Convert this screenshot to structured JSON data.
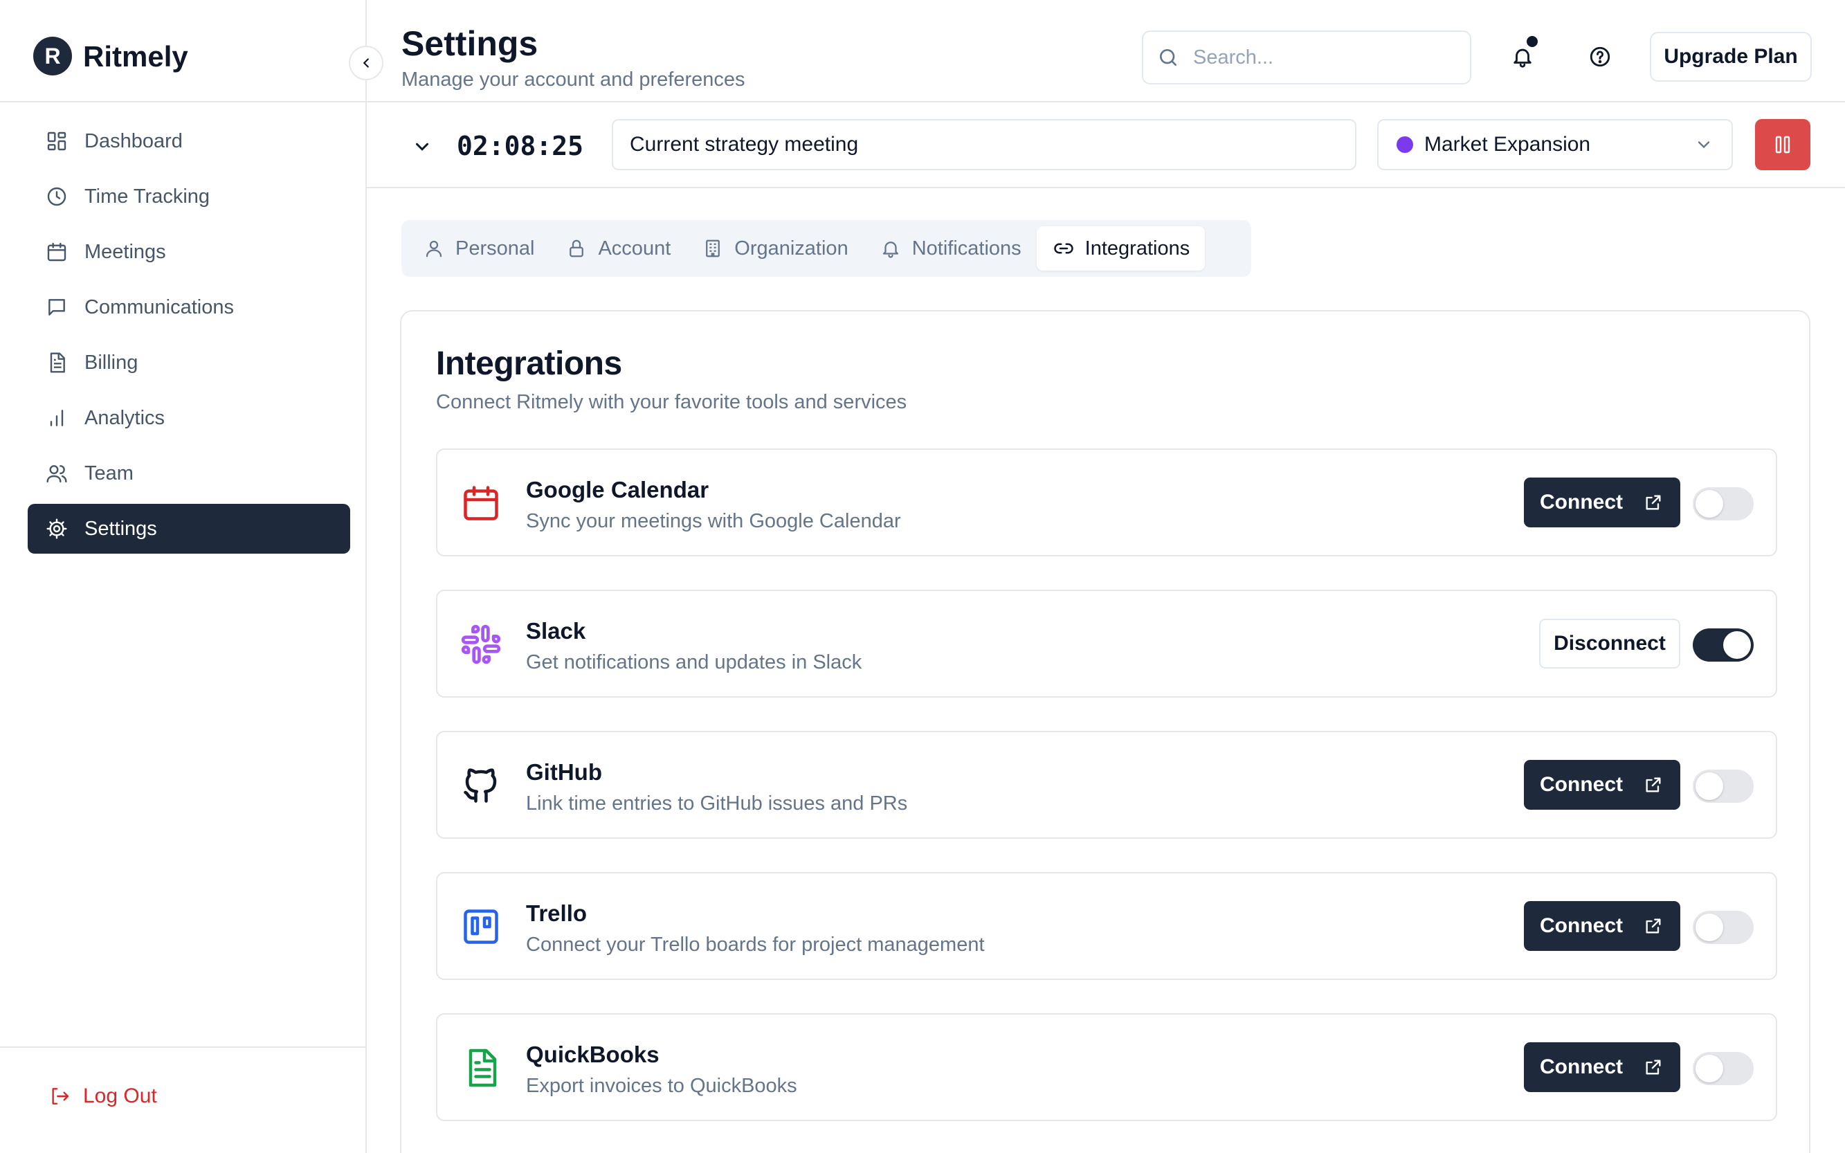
{
  "brand": {
    "initial": "R",
    "name": "Ritmely"
  },
  "sidebar": {
    "items": [
      {
        "label": "Dashboard",
        "icon": "dashboard-icon",
        "active": false
      },
      {
        "label": "Time Tracking",
        "icon": "clock-icon",
        "active": false
      },
      {
        "label": "Meetings",
        "icon": "calendar-icon",
        "active": false
      },
      {
        "label": "Communications",
        "icon": "message-icon",
        "active": false
      },
      {
        "label": "Billing",
        "icon": "file-icon",
        "active": false
      },
      {
        "label": "Analytics",
        "icon": "bar-chart-icon",
        "active": false
      },
      {
        "label": "Team",
        "icon": "users-icon",
        "active": false
      },
      {
        "label": "Settings",
        "icon": "gear-icon",
        "active": true
      }
    ],
    "logout_label": "Log Out"
  },
  "header": {
    "title": "Settings",
    "subtitle": "Manage your account and preferences",
    "search_placeholder": "Search...",
    "upgrade_label": "Upgrade Plan"
  },
  "timer": {
    "elapsed": "02:08:25",
    "description": "Current strategy meeting",
    "project": "Market Expansion",
    "project_color": "#7c3aed"
  },
  "tabs": [
    {
      "label": "Personal",
      "icon": "user-icon",
      "active": false
    },
    {
      "label": "Account",
      "icon": "lock-icon",
      "active": false
    },
    {
      "label": "Organization",
      "icon": "building-icon",
      "active": false
    },
    {
      "label": "Notifications",
      "icon": "bell-icon",
      "active": false
    },
    {
      "label": "Integrations",
      "icon": "link-icon",
      "active": true
    }
  ],
  "integrations_section": {
    "title": "Integrations",
    "subtitle": "Connect Ritmely with your favorite tools and services",
    "items": [
      {
        "name": "Google Calendar",
        "description": "Sync your meetings with Google Calendar",
        "icon": "google-calendar-icon",
        "icon_color": "#dc2626",
        "connected": false,
        "action_label": "Connect"
      },
      {
        "name": "Slack",
        "description": "Get notifications and updates in Slack",
        "icon": "slack-icon",
        "icon_color": "#a855f7",
        "connected": true,
        "action_label": "Disconnect"
      },
      {
        "name": "GitHub",
        "description": "Link time entries to GitHub issues and PRs",
        "icon": "github-icon",
        "icon_color": "#0f172a",
        "connected": false,
        "action_label": "Connect"
      },
      {
        "name": "Trello",
        "description": "Connect your Trello boards for project management",
        "icon": "trello-icon",
        "icon_color": "#2563eb",
        "connected": false,
        "action_label": "Connect"
      },
      {
        "name": "QuickBooks",
        "description": "Export invoices to QuickBooks",
        "icon": "quickbooks-icon",
        "icon_color": "#16a34a",
        "connected": false,
        "action_label": "Connect"
      }
    ]
  },
  "colors": {
    "primary": "#1e293b",
    "danger": "#dc4a4a",
    "muted_text": "#64748b",
    "border": "#e5e7eb"
  }
}
